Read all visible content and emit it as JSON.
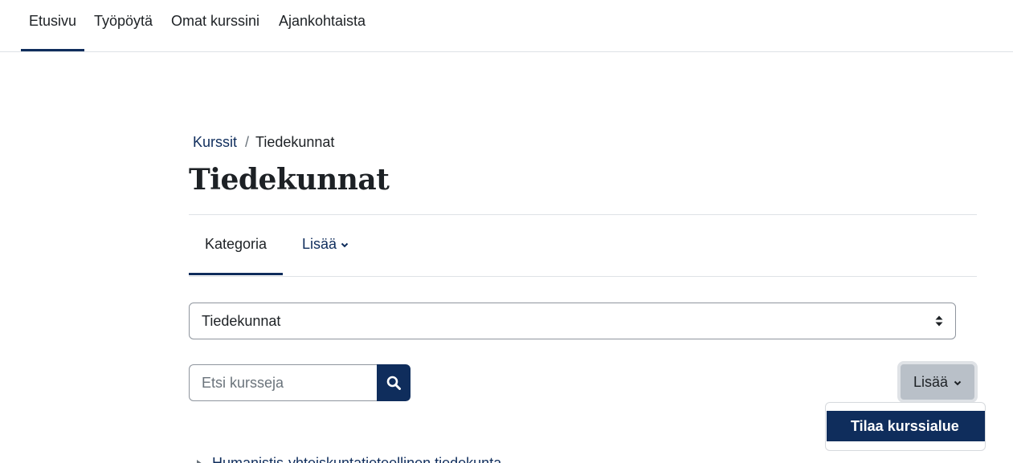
{
  "top_nav": {
    "items": [
      {
        "label": "Etusivu",
        "active": true
      },
      {
        "label": "Työpöytä",
        "active": false
      },
      {
        "label": "Omat kurssini",
        "active": false
      },
      {
        "label": "Ajankohtaista",
        "active": false
      }
    ]
  },
  "breadcrumb": {
    "items": [
      "Kurssit",
      "Tiedekunnat"
    ],
    "separator": "/"
  },
  "page": {
    "title": "Tiedekunnat"
  },
  "tabs": {
    "items": [
      {
        "label": "Kategoria",
        "active": true
      },
      {
        "label": "Lisää",
        "icon": "chevron-down-icon"
      }
    ]
  },
  "category_select": {
    "value": "Tiedekunnat",
    "icon": "updown-arrows-icon"
  },
  "search": {
    "placeholder": "Etsi kursseja",
    "button_icon": "search-icon"
  },
  "action_menu": {
    "label": "Lisää",
    "icon": "chevron-down-icon",
    "items": [
      "Tilaa kurssialue"
    ]
  },
  "categories": {
    "items": [
      "Humanistis-yhteiskuntatieteellinen tiedekunta"
    ]
  },
  "colors": {
    "brand_primary": "#0f2d5c",
    "text": "#1d2125",
    "border": "#dee2e6",
    "more_button_bg": "#b9c0c8"
  }
}
